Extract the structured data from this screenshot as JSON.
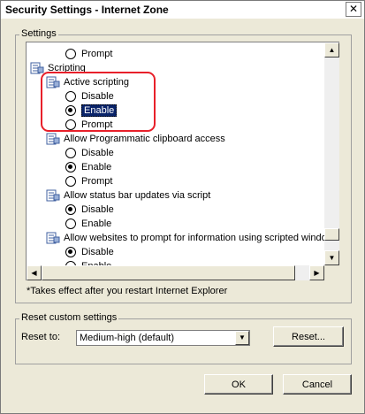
{
  "window": {
    "title": "Security Settings - Internet Zone",
    "close_glyph": "✕"
  },
  "settings_group": {
    "label": "Settings",
    "rows": [
      {
        "kind": "option",
        "label": "Prompt",
        "checked": false
      },
      {
        "kind": "category",
        "label": "Scripting",
        "icon": "settings-category-icon"
      },
      {
        "kind": "setting",
        "label": "Active scripting",
        "icon": "settings-item-icon"
      },
      {
        "kind": "option",
        "label": "Disable",
        "checked": false
      },
      {
        "kind": "option",
        "label": "Enable",
        "checked": true,
        "selected": true
      },
      {
        "kind": "option",
        "label": "Prompt",
        "checked": false
      },
      {
        "kind": "setting",
        "label": "Allow Programmatic clipboard access",
        "icon": "settings-item-icon"
      },
      {
        "kind": "option",
        "label": "Disable",
        "checked": false
      },
      {
        "kind": "option",
        "label": "Enable",
        "checked": true
      },
      {
        "kind": "option",
        "label": "Prompt",
        "checked": false
      },
      {
        "kind": "setting",
        "label": "Allow status bar updates via script",
        "icon": "settings-item-icon"
      },
      {
        "kind": "option",
        "label": "Disable",
        "checked": true
      },
      {
        "kind": "option",
        "label": "Enable",
        "checked": false
      },
      {
        "kind": "setting",
        "label": "Allow websites to prompt for information using scripted windo",
        "icon": "settings-item-icon"
      },
      {
        "kind": "option",
        "label": "Disable",
        "checked": true
      },
      {
        "kind": "option",
        "label": "Enable",
        "checked": false
      }
    ],
    "note": "*Takes effect after you restart Internet Explorer"
  },
  "reset_group": {
    "label": "Reset custom settings",
    "reset_to_label": "Reset to:",
    "reset_to_value": "Medium-high (default)",
    "reset_button": "Reset..."
  },
  "footer": {
    "ok_label": "OK",
    "cancel_label": "Cancel"
  }
}
